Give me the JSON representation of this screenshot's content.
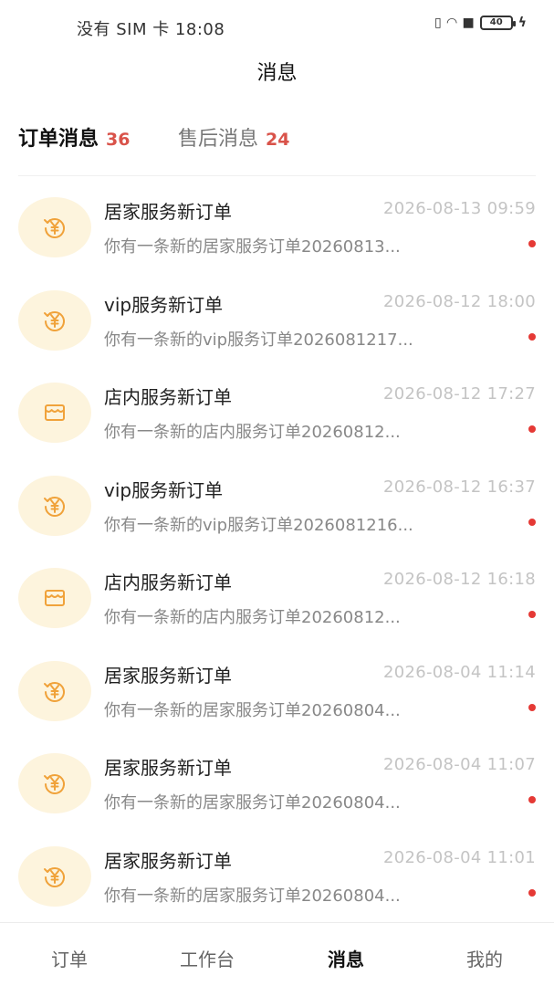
{
  "status_bar": {
    "left_text": "没有 SIM 卡 18:08",
    "battery": "40"
  },
  "header": {
    "title": "消息"
  },
  "tabs": [
    {
      "label": "订单消息",
      "count": "36",
      "active": true
    },
    {
      "label": "售后消息",
      "count": "24",
      "active": false
    }
  ],
  "messages": [
    {
      "icon": "yen-refresh-icon",
      "title": "居家服务新订单",
      "time": "2026-08-13 09:59",
      "preview": "你有一条新的居家服务订单20260813...",
      "unread": true
    },
    {
      "icon": "yen-refresh-icon",
      "title": "vip服务新订单",
      "time": "2026-08-12 18:00",
      "preview": "你有一条新的vip服务订单2026081217...",
      "unread": true
    },
    {
      "icon": "store-icon",
      "title": "店内服务新订单",
      "time": "2026-08-12 17:27",
      "preview": "你有一条新的店内服务订单20260812...",
      "unread": true
    },
    {
      "icon": "yen-refresh-icon",
      "title": "vip服务新订单",
      "time": "2026-08-12 16:37",
      "preview": "你有一条新的vip服务订单2026081216...",
      "unread": true
    },
    {
      "icon": "store-icon",
      "title": "店内服务新订单",
      "time": "2026-08-12 16:18",
      "preview": "你有一条新的店内服务订单20260812...",
      "unread": true
    },
    {
      "icon": "yen-refresh-icon",
      "title": "居家服务新订单",
      "time": "2026-08-04 11:14",
      "preview": "你有一条新的居家服务订单20260804...",
      "unread": true
    },
    {
      "icon": "yen-refresh-icon",
      "title": "居家服务新订单",
      "time": "2026-08-04 11:07",
      "preview": "你有一条新的居家服务订单20260804...",
      "unread": true
    },
    {
      "icon": "yen-refresh-icon",
      "title": "居家服务新订单",
      "time": "2026-08-04 11:01",
      "preview": "你有一条新的居家服务订单20260804...",
      "unread": true
    }
  ],
  "bottom_nav": [
    {
      "label": "订单",
      "active": false
    },
    {
      "label": "工作台",
      "active": false
    },
    {
      "label": "消息",
      "active": true
    },
    {
      "label": "我的",
      "active": false
    }
  ],
  "colors": {
    "accent_red": "#d9534a",
    "unread_dot": "#e53935",
    "icon_orange": "#f0a23a",
    "avatar_bg": "#fdf4dd"
  }
}
